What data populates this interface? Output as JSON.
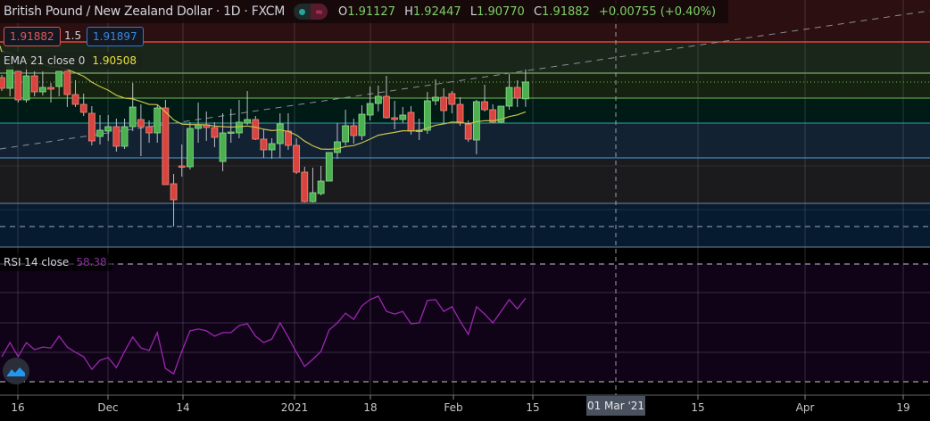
{
  "header": {
    "title": "British Pound / New Zealand Dollar · 1D · FXCM",
    "ohlc": {
      "o_label": "O",
      "o": "1.91127",
      "h_label": "H",
      "h": "1.92447",
      "l_label": "L",
      "l": "1.90770",
      "c_label": "C",
      "c": "1.91882",
      "change": "+0.00755 (+0.40%)"
    },
    "toggle_icon": "wave-icon"
  },
  "trade": {
    "bid": "1.91882",
    "qty": "1.5",
    "ask": "1.91897"
  },
  "indicators": {
    "ema": {
      "label": "EMA 21 close 0",
      "value": "1.90508"
    },
    "rsi": {
      "label": "RSI 14 close",
      "value": "58.38"
    }
  },
  "x_axis": {
    "ticks": [
      {
        "label": "16"
      },
      {
        "label": "Dec"
      },
      {
        "label": "14"
      },
      {
        "label": "2021"
      },
      {
        "label": "18"
      },
      {
        "label": "Feb"
      },
      {
        "label": "15"
      },
      {
        "label": "15"
      },
      {
        "label": "Apr"
      },
      {
        "label": "19"
      }
    ],
    "crosshair_label": "01 Mar '21"
  },
  "colors": {
    "up": "#4caf50",
    "down": "#d9453e",
    "ema": "#c8c44a",
    "rsi": "#9c27b0"
  },
  "chart_data": {
    "type": "candlestick",
    "symbol": "GBPNZD",
    "interval": "1D",
    "candles": [
      [
        1.9208,
        1.922,
        1.9148,
        1.916
      ],
      [
        1.916,
        1.9276,
        1.9124,
        1.926
      ],
      [
        1.9236,
        1.9236,
        1.9096,
        1.9108
      ],
      [
        1.9108,
        1.9264,
        1.9096,
        1.9216
      ],
      [
        1.9216,
        1.9236,
        1.9124,
        1.9144
      ],
      [
        1.9144,
        1.9236,
        1.9128,
        1.9164
      ],
      [
        1.9164,
        1.9184,
        1.9096,
        1.9156
      ],
      [
        1.9168,
        1.9236,
        1.9124,
        1.9236
      ],
      [
        1.9236,
        1.9236,
        1.9076,
        1.9132
      ],
      [
        1.9132,
        1.9196,
        1.9076,
        1.9088
      ],
      [
        1.9088,
        1.9136,
        1.9036,
        1.9052
      ],
      [
        1.9048,
        1.908,
        1.8904,
        1.8924
      ],
      [
        1.8944,
        1.904,
        1.8908,
        1.8972
      ],
      [
        1.8968,
        1.904,
        1.8924,
        1.8988
      ],
      [
        1.8988,
        1.9024,
        1.8876,
        1.89
      ],
      [
        1.89,
        1.9024,
        1.8888,
        1.8988
      ],
      [
        1.8988,
        1.9184,
        1.8968,
        1.9076
      ],
      [
        1.902,
        1.9088,
        1.8856,
        1.8988
      ],
      [
        1.8988,
        1.9016,
        1.8916,
        1.896
      ],
      [
        1.896,
        1.9088,
        1.8916,
        1.9072
      ],
      [
        1.9072,
        1.9108,
        1.8728,
        1.8728
      ],
      [
        1.8732,
        1.8776,
        1.854,
        1.866
      ],
      [
        1.8812,
        1.8908,
        1.8764,
        1.8808
      ],
      [
        1.8808,
        1.9008,
        1.8796,
        1.898
      ],
      [
        1.898,
        1.9096,
        1.8916,
        1.8996
      ],
      [
        1.8996,
        1.9056,
        1.8924,
        1.8984
      ],
      [
        1.8984,
        1.9008,
        1.8896,
        1.894
      ],
      [
        1.8832,
        1.9048,
        1.8788,
        1.896
      ],
      [
        1.896,
        1.9068,
        1.8916,
        1.8964
      ],
      [
        1.896,
        1.9108,
        1.8936,
        1.9008
      ],
      [
        1.9004,
        1.9148,
        1.8996,
        1.902
      ],
      [
        1.902,
        1.9036,
        1.8928,
        1.8932
      ],
      [
        1.8932,
        1.8976,
        1.8848,
        1.8884
      ],
      [
        1.8884,
        1.8936,
        1.8844,
        1.8912
      ],
      [
        1.8912,
        1.9048,
        1.8848,
        1.9
      ],
      [
        1.8968,
        1.9048,
        1.8884,
        1.8904
      ],
      [
        1.8904,
        1.8936,
        1.8776,
        1.8784
      ],
      [
        1.8784,
        1.8808,
        1.8648,
        1.8652
      ],
      [
        1.8652,
        1.8804,
        1.8648,
        1.8692
      ],
      [
        1.8688,
        1.8812,
        1.868,
        1.8744
      ],
      [
        1.8744,
        1.8872,
        1.8744,
        1.8872
      ],
      [
        1.8872,
        1.9004,
        1.8844,
        1.892
      ],
      [
        1.892,
        1.9064,
        1.8904,
        1.8992
      ],
      [
        1.8992,
        1.9024,
        1.8912,
        1.8948
      ],
      [
        1.8948,
        1.9084,
        1.8928,
        1.9044
      ],
      [
        1.904,
        1.9168,
        1.9016,
        1.9092
      ],
      [
        1.9092,
        1.9172,
        1.9056,
        1.9124
      ],
      [
        1.9124,
        1.9216,
        1.9024,
        1.9028
      ],
      [
        1.9028,
        1.9104,
        1.8976,
        1.902
      ],
      [
        1.902,
        1.9076,
        1.9004,
        1.904
      ],
      [
        1.9052,
        1.908,
        1.8952,
        1.8968
      ],
      [
        1.8968,
        1.9024,
        1.8928,
        1.8972
      ],
      [
        1.8972,
        1.9144,
        1.8956,
        1.9104
      ],
      [
        1.9104,
        1.92,
        1.9084,
        1.912
      ],
      [
        1.912,
        1.916,
        1.9004,
        1.906
      ],
      [
        1.9136,
        1.9148,
        1.9048,
        1.9088
      ],
      [
        1.9088,
        1.912,
        1.8992,
        1.9004
      ],
      [
        1.9,
        1.9016,
        1.892,
        1.8932
      ],
      [
        1.8928,
        1.9108,
        1.8864,
        1.91
      ],
      [
        1.91,
        1.9176,
        1.9056,
        1.9064
      ],
      [
        1.9064,
        1.9088,
        1.9004,
        1.9008
      ],
      [
        1.9008,
        1.908,
        1.9004,
        1.908
      ],
      [
        1.908,
        1.9224,
        1.9064,
        1.9164
      ],
      [
        1.9164,
        1.9196,
        1.9076,
        1.9116
      ],
      [
        1.91127,
        1.92447,
        1.9077,
        1.91882
      ]
    ],
    "rsi": [
      38.5,
      43.3,
      38.5,
      43.3,
      40.9,
      41.8,
      41.5,
      45.5,
      41.8,
      40.0,
      38.5,
      34.2,
      37.3,
      38.2,
      34.8,
      40.3,
      45.2,
      41.5,
      40.6,
      46.7,
      34.5,
      32.7,
      40.3,
      47.3,
      47.9,
      47.3,
      45.5,
      46.7,
      46.7,
      49.1,
      49.7,
      45.5,
      43.3,
      44.5,
      50.0,
      45.2,
      40.0,
      35.2,
      37.6,
      40.3,
      47.6,
      50.0,
      53.3,
      51.2,
      55.8,
      57.9,
      59.1,
      53.9,
      53.0,
      53.9,
      49.7,
      50.0,
      57.6,
      57.9,
      53.9,
      55.5,
      50.6,
      46.1,
      55.5,
      53.0,
      50.0,
      53.9,
      57.9,
      54.8,
      58.38
    ],
    "rsi_levels": [
      70,
      30
    ]
  }
}
